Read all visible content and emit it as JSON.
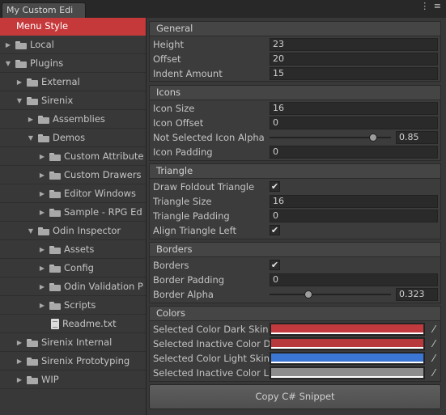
{
  "window": {
    "tab_title": "My Custom Edi",
    "window_controls": [
      "⋮",
      "≡"
    ]
  },
  "sidebar": {
    "items": [
      {
        "label": "Menu Style",
        "selected": true,
        "arrow": "",
        "icon": "none"
      },
      {
        "label": "Local",
        "arrow": "▶",
        "icon": "folder-icon"
      },
      {
        "label": "Plugins",
        "arrow": "▼",
        "icon": "folder-icon"
      },
      {
        "label": "External",
        "arrow": "▶",
        "icon": "folder-icon"
      },
      {
        "label": "Sirenix",
        "arrow": "▼",
        "icon": "folder-icon"
      },
      {
        "label": "Assemblies",
        "arrow": "▶",
        "icon": "folder-icon"
      },
      {
        "label": "Demos",
        "arrow": "▼",
        "icon": "folder-icon"
      },
      {
        "label": "Custom Attribute",
        "arrow": "▶",
        "icon": "folder-icon"
      },
      {
        "label": "Custom Drawers",
        "arrow": "▶",
        "icon": "folder-icon"
      },
      {
        "label": "Editor Windows",
        "arrow": "▶",
        "icon": "folder-icon"
      },
      {
        "label": "Sample - RPG Ed",
        "arrow": "▶",
        "icon": "folder-icon"
      },
      {
        "label": "Odin Inspector",
        "arrow": "▼",
        "icon": "folder-icon"
      },
      {
        "label": "Assets",
        "arrow": "▶",
        "icon": "folder-icon"
      },
      {
        "label": "Config",
        "arrow": "▶",
        "icon": "folder-icon"
      },
      {
        "label": "Odin Validation P",
        "arrow": "▶",
        "icon": "folder-icon"
      },
      {
        "label": "Scripts",
        "arrow": "▶",
        "icon": "folder-icon"
      },
      {
        "label": "Readme.txt",
        "arrow": "",
        "icon": "text-file-icon"
      },
      {
        "label": "Sirenix Internal",
        "arrow": "▶",
        "icon": "folder-icon"
      },
      {
        "label": "Sirenix Prototyping",
        "arrow": "▶",
        "icon": "folder-icon"
      },
      {
        "label": "WIP",
        "arrow": "▶",
        "icon": "folder-icon"
      }
    ]
  },
  "general": {
    "header": "General",
    "height_label": "Height",
    "height_value": "23",
    "offset_label": "Offset",
    "offset_value": "20",
    "indent_label": "Indent Amount",
    "indent_value": "15"
  },
  "icons": {
    "header": "Icons",
    "size_label": "Icon Size",
    "size_value": "16",
    "offset_label": "Icon Offset",
    "offset_value": "0",
    "alpha_label": "Not Selected Icon Alpha",
    "alpha_value": "0.85",
    "alpha_fraction": 0.85,
    "padding_label": "Icon Padding",
    "padding_value": "0"
  },
  "triangle": {
    "header": "Triangle",
    "draw_label": "Draw Foldout Triangle",
    "draw_checked": true,
    "size_label": "Triangle Size",
    "size_value": "16",
    "padding_label": "Triangle Padding",
    "padding_value": "0",
    "align_label": "Align Triangle Left",
    "align_checked": true
  },
  "borders": {
    "header": "Borders",
    "borders_label": "Borders",
    "borders_checked": true,
    "padding_label": "Border Padding",
    "padding_value": "0",
    "alpha_label": "Border Alpha",
    "alpha_value": "0.323",
    "alpha_fraction": 0.323
  },
  "colors": {
    "header": "Colors",
    "items": [
      {
        "label": "Selected Color Dark Skin",
        "color": "#c23a3d"
      },
      {
        "label": "Selected Inactive Color Dark Skin",
        "color": "#b8393b"
      },
      {
        "label": "Selected Color Light Skin",
        "color": "#3b76d4"
      },
      {
        "label": "Selected Inactive Color Light Skin",
        "color": "#8d8d8d"
      }
    ]
  },
  "copy_button_label": "Copy C# Snippet",
  "checkmark": "✔",
  "picker_glyph": "⁄"
}
